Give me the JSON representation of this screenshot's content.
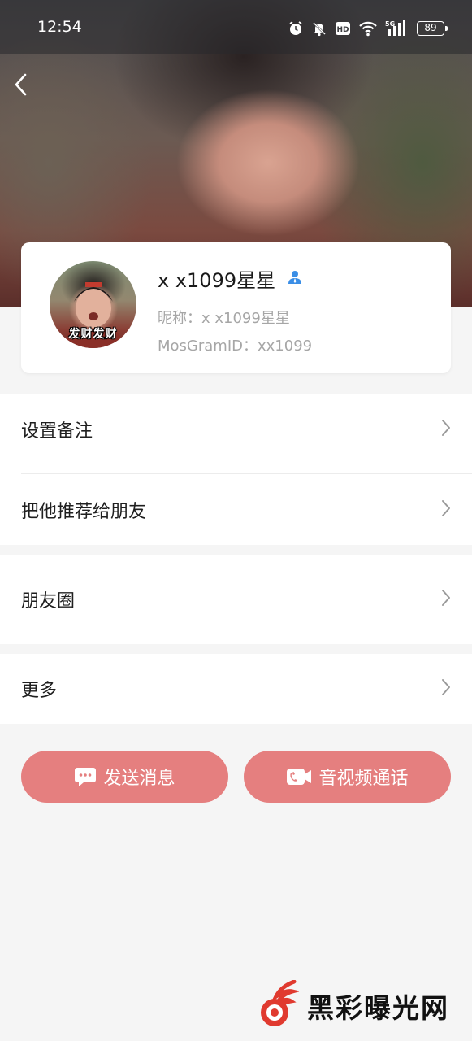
{
  "status_bar": {
    "time": "12:54",
    "icons": [
      "alarm-icon",
      "mute-icon",
      "hd-icon",
      "wifi-icon",
      "5g-signal-icon"
    ],
    "battery": "89"
  },
  "header": {
    "back_icon": "back-chevron-icon"
  },
  "profile": {
    "display_name": "x x1099星星",
    "avatar_caption": "发财发财",
    "nickname": "昵称：x x1099星星",
    "mosgram_id": "MosGramID：xx1099",
    "badge_icon": "person-icon",
    "badge_color": "#3a8ee6"
  },
  "menu": {
    "set_remark": "设置备注",
    "recommend": "把他推荐给朋友",
    "moments": "朋友圈",
    "more": "更多"
  },
  "actions": {
    "send_message": "发送消息",
    "av_call": "音视频通话",
    "button_color": "#e57f7f"
  },
  "watermark": {
    "text": "黑彩曝光网",
    "logo_color": "#e03a2f"
  }
}
